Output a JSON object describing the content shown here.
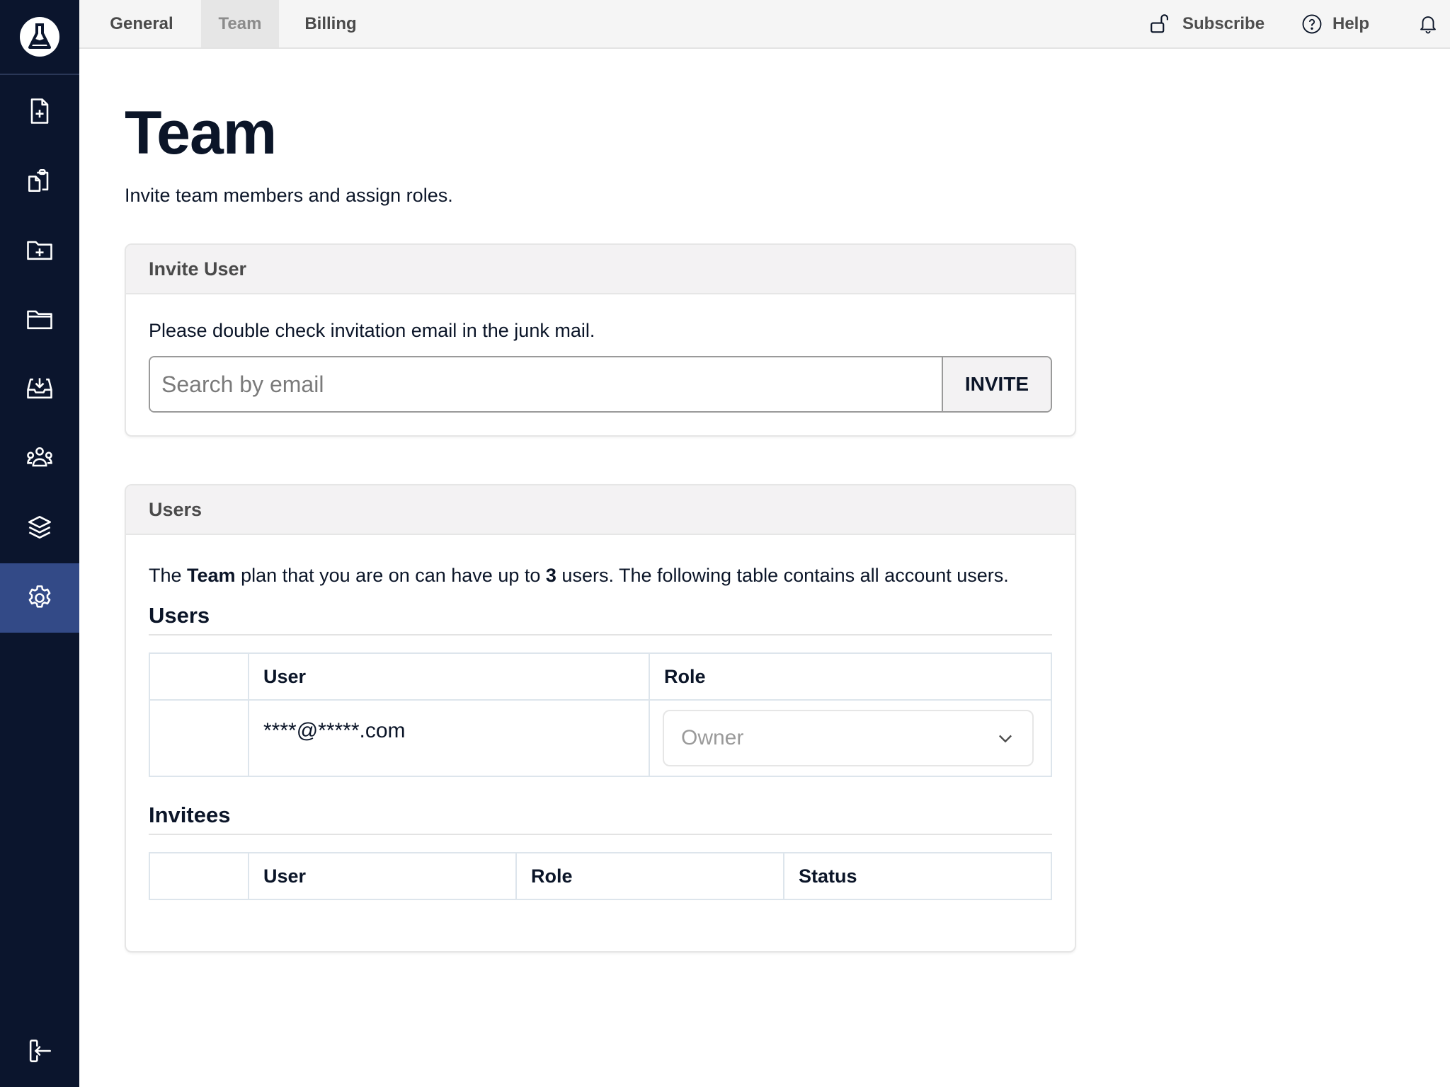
{
  "sidebar": {
    "logo": "flask-logo",
    "items": [
      {
        "icon": "file-plus-icon",
        "label": "New document"
      },
      {
        "icon": "clipboard-copy-icon",
        "label": "Documents"
      },
      {
        "icon": "folder-plus-icon",
        "label": "New folder"
      },
      {
        "icon": "folder-icon",
        "label": "Folders"
      },
      {
        "icon": "inbox-download-icon",
        "label": "Inbox"
      },
      {
        "icon": "users-group-icon",
        "label": "Team"
      },
      {
        "icon": "layers-icon",
        "label": "Layers"
      },
      {
        "icon": "gear-icon",
        "label": "Settings",
        "active": true
      }
    ],
    "logout_icon": "logout-icon"
  },
  "topbar": {
    "tabs": [
      {
        "label": "General"
      },
      {
        "label": "Team",
        "active": true
      },
      {
        "label": "Billing"
      }
    ],
    "subscribe_label": "Subscribe",
    "help_label": "Help"
  },
  "page": {
    "title": "Team",
    "subtitle": "Invite team members and assign roles."
  },
  "invite_card": {
    "header": "Invite User",
    "hint": "Please double check invitation email in the junk mail.",
    "email_placeholder": "Search by email",
    "invite_button": "INVITE"
  },
  "users_card": {
    "header": "Users",
    "plan_text_1": "The ",
    "plan_name": "Team",
    "plan_text_2": " plan that you are on can have up to ",
    "max_users": "3",
    "plan_text_3": " users. The following table contains all account users.",
    "users_title": "Users",
    "users_columns": [
      "",
      "User",
      "Role"
    ],
    "users_rows": [
      {
        "user": "****@*****.com",
        "role": "Owner"
      }
    ],
    "invitees_title": "Invitees",
    "invitees_columns": [
      "",
      "User",
      "Role",
      "Status"
    ]
  },
  "colors": {
    "sidebar_bg": "#0b152d",
    "sidebar_active": "#334a87",
    "text": "#0b1528"
  }
}
